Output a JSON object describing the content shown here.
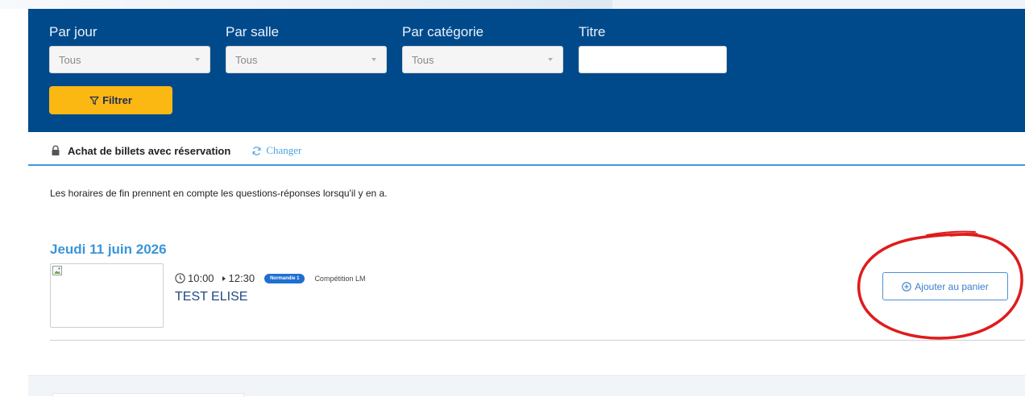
{
  "filters": {
    "day": {
      "label": "Par jour",
      "value": "Tous"
    },
    "room": {
      "label": "Par salle",
      "value": "Tous"
    },
    "category": {
      "label": "Par catégorie",
      "value": "Tous"
    },
    "title": {
      "label": "Titre",
      "value": ""
    },
    "button_label": "Filtrer"
  },
  "booking_mode": {
    "text": "Achat de billets avec réservation",
    "change_label": "Changer"
  },
  "notice": "Les horaires de fin prennent en compte les questions-réponses lorsqu'il y en a.",
  "schedule": {
    "date": "Jeudi 11 juin 2026",
    "event": {
      "start": "10:00",
      "end": "12:30",
      "room": "Normandie 1",
      "category": "Compétition LM",
      "title": "TEST ELISE",
      "add_label": "Ajouter au panier"
    }
  },
  "colors": {
    "panel": "#004a8c",
    "accent_yellow": "#fbb812",
    "link_blue": "#3a95da",
    "annotation_red": "#e01b1b"
  }
}
